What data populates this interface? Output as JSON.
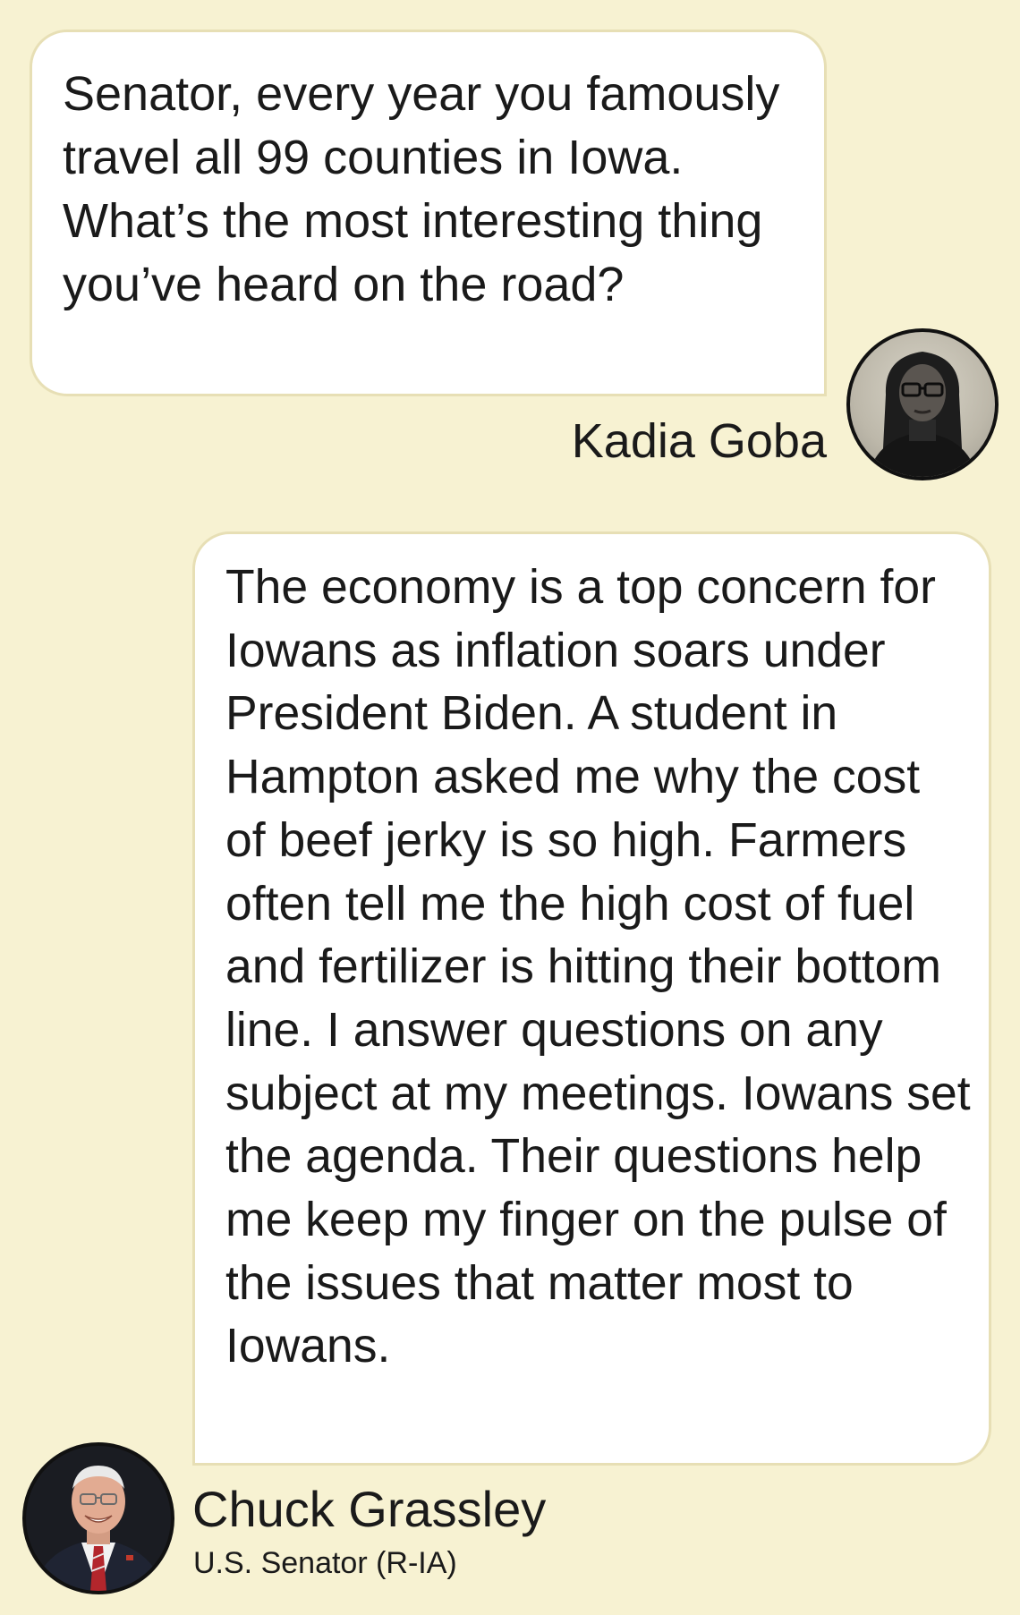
{
  "question": {
    "text": "Senator, every year you famously travel all 99 counties in Iowa. What’s the most interesting thing you’ve heard on the road?",
    "author": "Kadia Goba"
  },
  "answer": {
    "text": "The economy is a top concern for Iowans as inflation soars under President Biden. A student in Hampton asked me why the cost of beef jerky is so high. Farmers often tell me the high cost of fuel and fertilizer is hitting their bottom line. I answer questions on any subject at my meetings. Iowans set the agenda. Their questions help me keep my finger on the pulse of the issues that matter most to Iowans.",
    "author": "Chuck Grassley",
    "author_title": "U.S. Senator (R-IA)"
  },
  "colors": {
    "background": "#f7f2d2",
    "bubble": "#ffffff",
    "bubble_border": "#e7dfb5",
    "text": "#1a1a1a"
  }
}
